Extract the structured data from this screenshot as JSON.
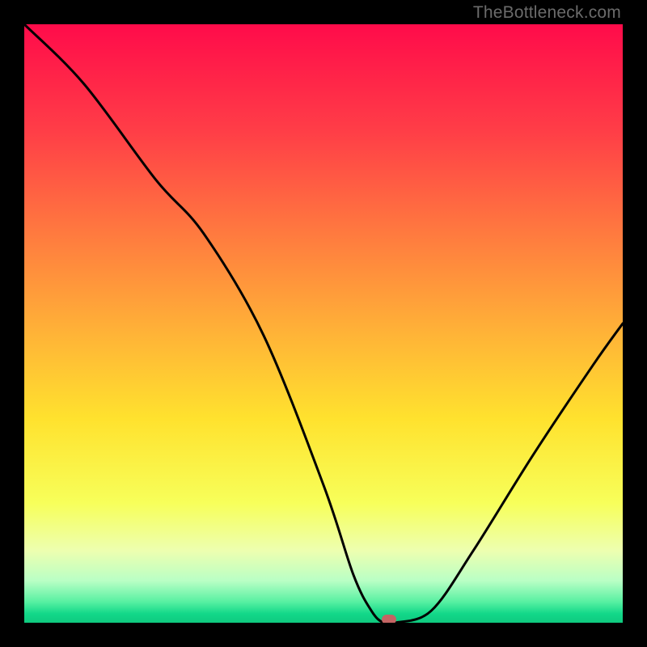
{
  "watermark": "TheBottleneck.com",
  "chart_data": {
    "type": "line",
    "title": "",
    "xlabel": "",
    "ylabel": "",
    "xlim": [
      0,
      100
    ],
    "ylim": [
      0,
      100
    ],
    "x": [
      0,
      10,
      22,
      30,
      40,
      50,
      55,
      58,
      60,
      62,
      68,
      75,
      85,
      95,
      100
    ],
    "values": [
      100,
      90,
      74,
      65,
      48,
      23,
      8,
      2,
      0,
      0,
      2,
      12,
      28,
      43,
      50
    ],
    "marker": {
      "x": 61,
      "y": 0.5
    },
    "gradient_stops": [
      {
        "pos": 0,
        "color": "#ff0b4a"
      },
      {
        "pos": 0.18,
        "color": "#ff3e47"
      },
      {
        "pos": 0.35,
        "color": "#ff7a3f"
      },
      {
        "pos": 0.52,
        "color": "#ffb437"
      },
      {
        "pos": 0.66,
        "color": "#ffe22e"
      },
      {
        "pos": 0.8,
        "color": "#f7ff5a"
      },
      {
        "pos": 0.88,
        "color": "#edffb0"
      },
      {
        "pos": 0.93,
        "color": "#b9ffc5"
      },
      {
        "pos": 0.965,
        "color": "#58f0a2"
      },
      {
        "pos": 0.985,
        "color": "#12d889"
      },
      {
        "pos": 1.0,
        "color": "#0fc97f"
      }
    ],
    "marker_color": "#c46463",
    "curve_color": "#000000"
  }
}
